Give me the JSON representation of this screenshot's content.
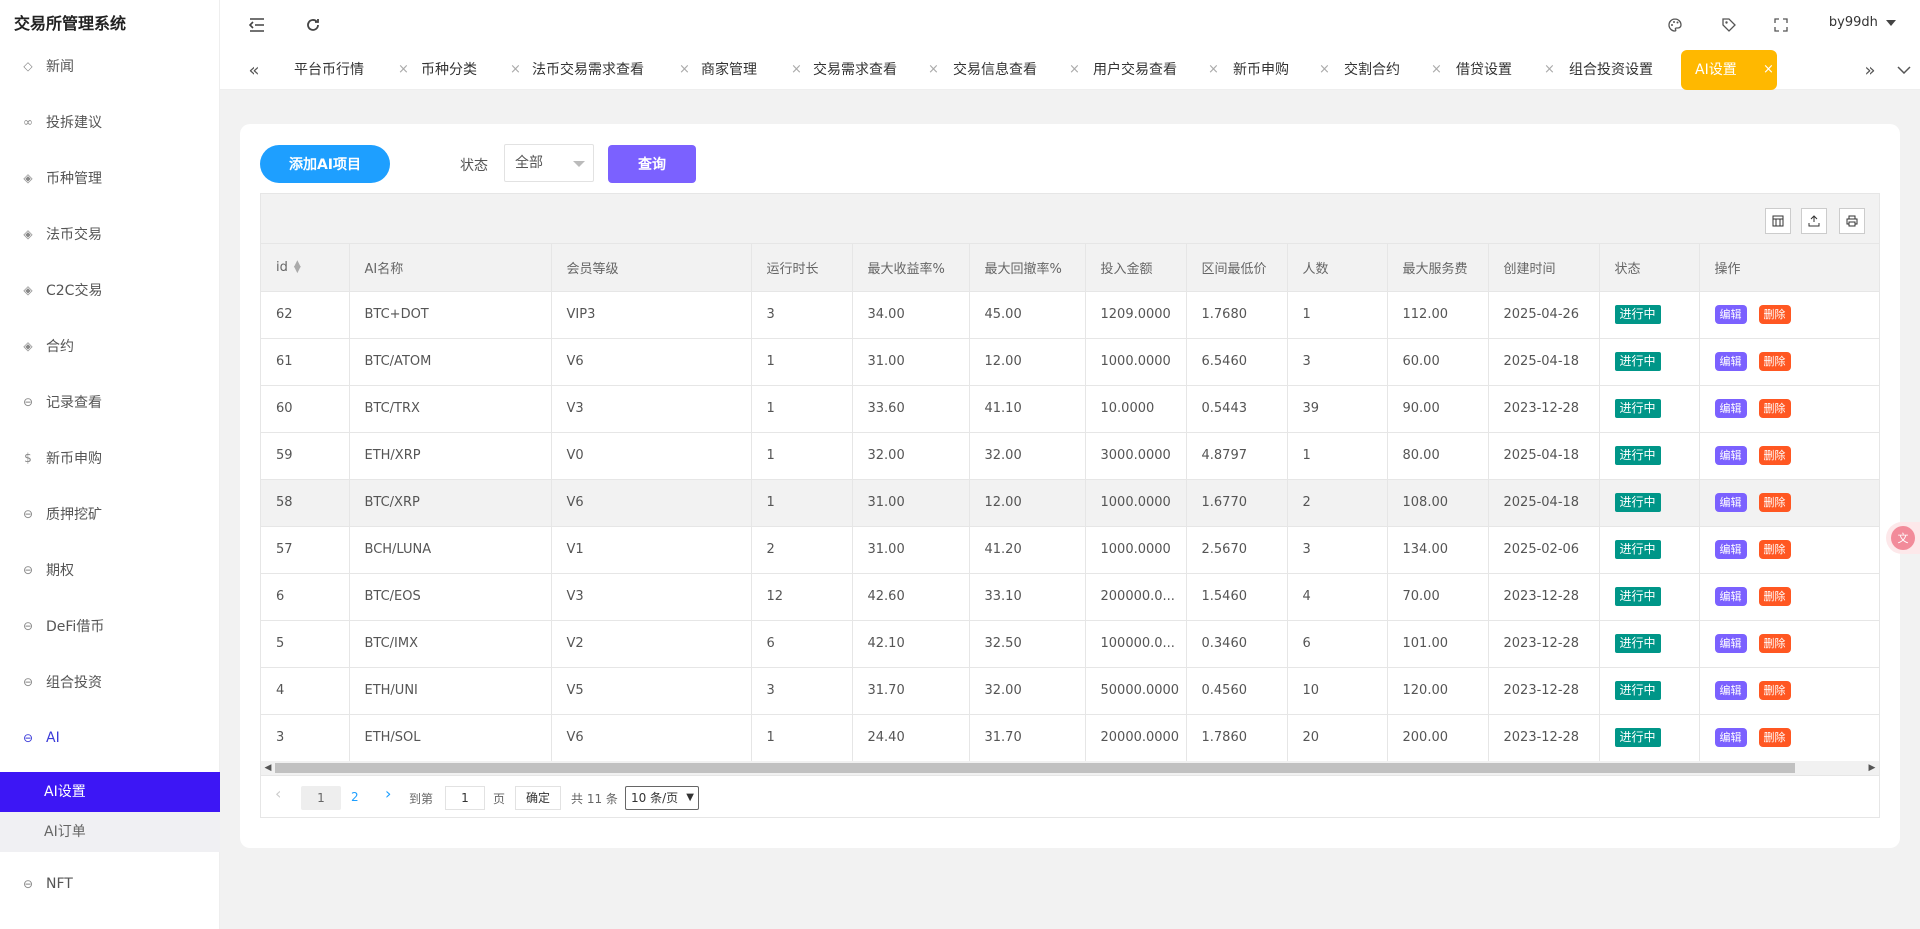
{
  "app": {
    "title": "交易所管理系统"
  },
  "sidebar": {
    "items": [
      {
        "label": "新闻",
        "icon": "tag-icon"
      },
      {
        "label": "投拆建议",
        "icon": "infinity-icon"
      },
      {
        "label": "币种管理",
        "icon": "diamond-icon"
      },
      {
        "label": "法币交易",
        "icon": "diamond-icon"
      },
      {
        "label": "C2C交易",
        "icon": "diamond-icon"
      },
      {
        "label": "合约",
        "icon": "diamond-icon"
      },
      {
        "label": "记录查看",
        "icon": "circle-arrow-icon"
      },
      {
        "label": "新币申购",
        "icon": "dollar-icon"
      },
      {
        "label": "质押挖矿",
        "icon": "circle-arrow-icon"
      },
      {
        "label": "期权",
        "icon": "circle-arrow-icon"
      },
      {
        "label": "DeFi借币",
        "icon": "circle-arrow-icon"
      },
      {
        "label": "组合投资",
        "icon": "circle-arrow-icon"
      },
      {
        "label": "AI",
        "icon": "circle-arrow-icon"
      },
      {
        "label": "NFT",
        "icon": "circle-arrow-icon"
      }
    ],
    "ai_sub": {
      "settings": "AI设置",
      "orders": "AI订单"
    }
  },
  "header": {
    "user": "by99dh"
  },
  "tabs": [
    "平台币行情",
    "币种分类",
    "法币交易需求查看",
    "商家管理",
    "交易需求查看",
    "交易信息查看",
    "用户交易查看",
    "新币申购",
    "交割合约",
    "借贷设置",
    "组合投资设置",
    "AI设置"
  ],
  "tab_close": "×",
  "toolbar": {
    "add_label": "添加AI项目",
    "status_label": "状态",
    "status_value": "全部",
    "query_label": "查询"
  },
  "table": {
    "columns": [
      "id",
      "AI名称",
      "会员等级",
      "运行时长",
      "最大收益率%",
      "最大回撤率%",
      "投入金额",
      "区间最低价",
      "人数",
      "最大服务费",
      "创建时间",
      "状态",
      "操作"
    ],
    "rows": [
      [
        "62",
        "BTC+DOT",
        "VIP3",
        "3",
        "34.00",
        "45.00",
        "1209.0000",
        "1.7680",
        "1",
        "112.00",
        "2025-04-26",
        "进行中"
      ],
      [
        "61",
        "BTC/ATOM",
        "V6",
        "1",
        "31.00",
        "12.00",
        "1000.0000",
        "6.5460",
        "3",
        "60.00",
        "2025-04-18",
        "进行中"
      ],
      [
        "60",
        "BTC/TRX",
        "V3",
        "1",
        "33.60",
        "41.10",
        "10.0000",
        "0.5443",
        "39",
        "90.00",
        "2023-12-28",
        "进行中"
      ],
      [
        "59",
        "ETH/XRP",
        "V0",
        "1",
        "32.00",
        "32.00",
        "3000.0000",
        "4.8797",
        "1",
        "80.00",
        "2025-04-18",
        "进行中"
      ],
      [
        "58",
        "BTC/XRP",
        "V6",
        "1",
        "31.00",
        "12.00",
        "1000.0000",
        "1.6770",
        "2",
        "108.00",
        "2025-04-18",
        "进行中"
      ],
      [
        "57",
        "BCH/LUNA",
        "V1",
        "2",
        "31.00",
        "41.20",
        "1000.0000",
        "2.5670",
        "3",
        "134.00",
        "2025-02-06",
        "进行中"
      ],
      [
        "6",
        "BTC/EOS",
        "V3",
        "12",
        "42.60",
        "33.10",
        "200000.0...",
        "1.5460",
        "4",
        "70.00",
        "2023-12-28",
        "进行中"
      ],
      [
        "5",
        "BTC/IMX",
        "V2",
        "6",
        "42.10",
        "32.50",
        "100000.0...",
        "0.3460",
        "6",
        "101.00",
        "2023-12-28",
        "进行中"
      ],
      [
        "4",
        "ETH/UNI",
        "V5",
        "3",
        "31.70",
        "32.00",
        "50000.0000",
        "0.4560",
        "10",
        "120.00",
        "2023-12-28",
        "进行中"
      ],
      [
        "3",
        "ETH/SOL",
        "V6",
        "1",
        "24.40",
        "31.70",
        "20000.0000",
        "1.7860",
        "20",
        "200.00",
        "2023-12-28",
        "进行中"
      ]
    ],
    "edit_label": "编辑",
    "delete_label": "删除"
  },
  "pager": {
    "prev": "‹",
    "page1": "1",
    "page2": "2",
    "next": "›",
    "goto_label": "到第",
    "goto_value": "1",
    "page_unit": "页",
    "confirm": "确定",
    "total": "共 11 条",
    "per_page": "10 条/页"
  },
  "colors": {
    "accent": "#3d16f5",
    "active_tab": "#ffb800",
    "add_button": "#1e9fff",
    "query_button": "#7b61ff",
    "status_badge": "#009688",
    "delete": "#ff5722"
  }
}
